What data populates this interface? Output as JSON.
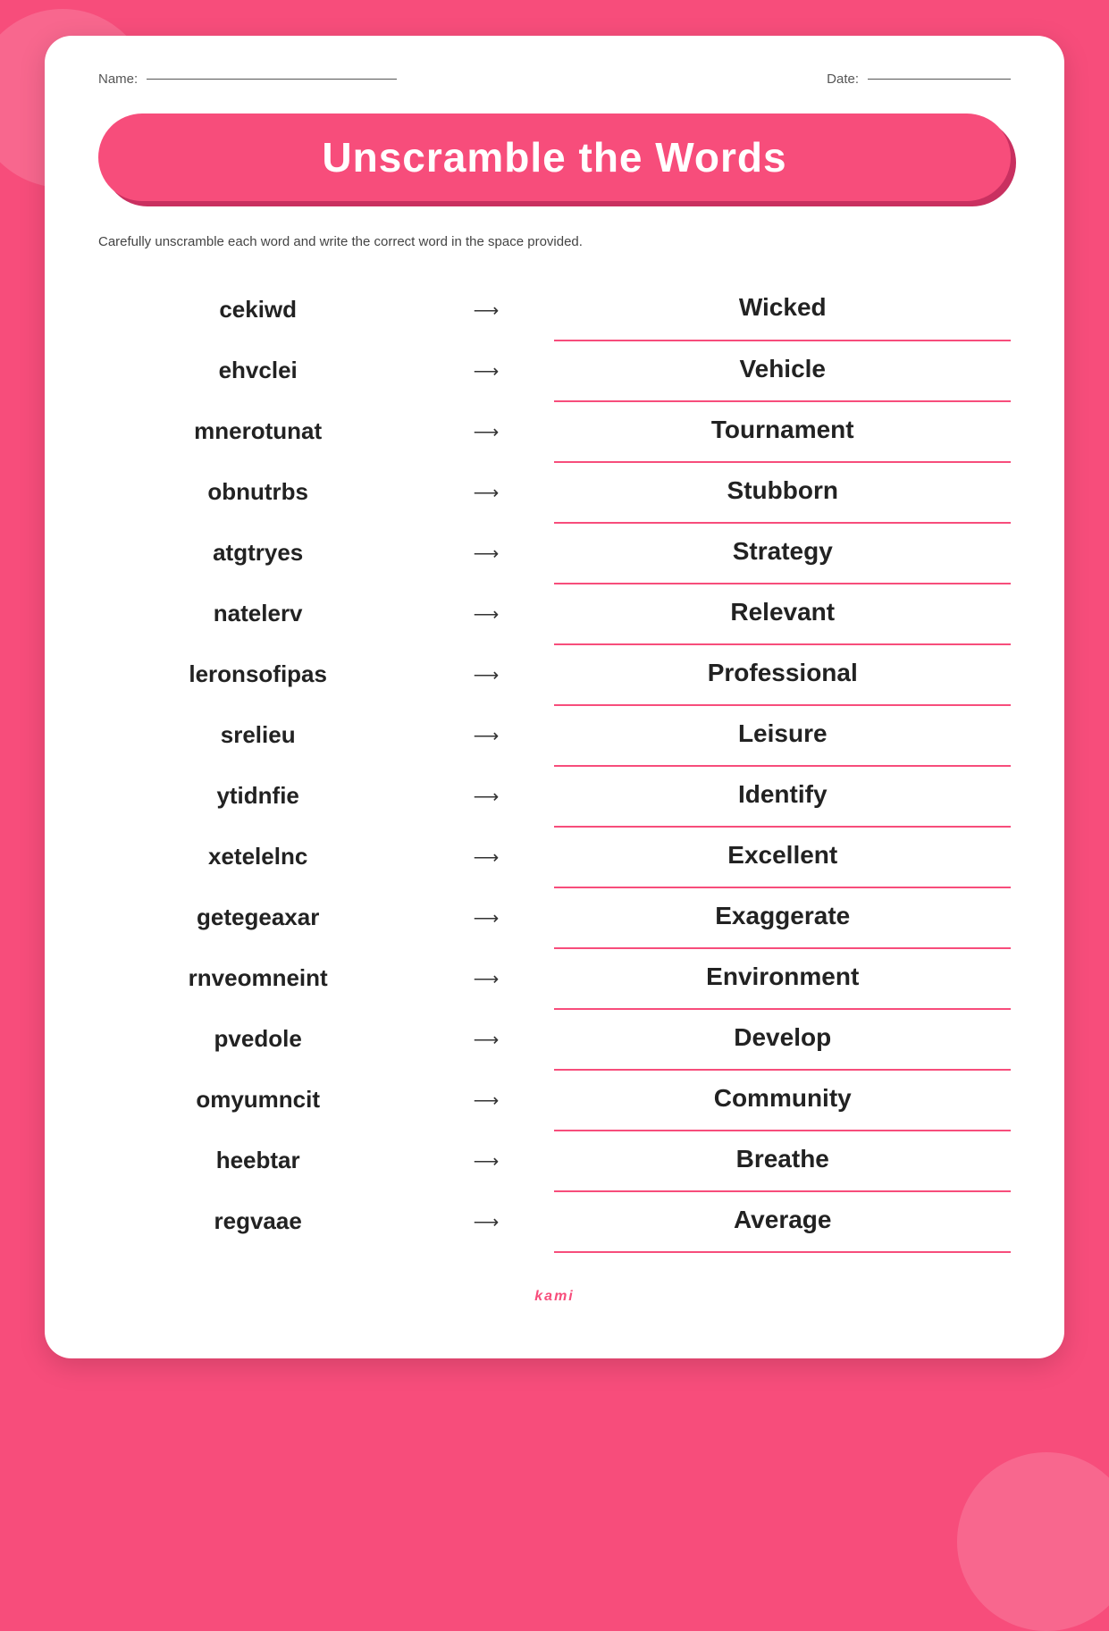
{
  "header": {
    "name_label": "Name:",
    "date_label": "Date:"
  },
  "title": "Unscramble the Words",
  "instructions": "Carefully unscramble each word and write the correct word in the space provided.",
  "words": [
    {
      "scrambled": "cekiwd",
      "answer": "Wicked"
    },
    {
      "scrambled": "ehvclei",
      "answer": "Vehicle"
    },
    {
      "scrambled": "mnerotunat",
      "answer": "Tournament"
    },
    {
      "scrambled": "obnutrbs",
      "answer": "Stubborn"
    },
    {
      "scrambled": "atgtryes",
      "answer": "Strategy"
    },
    {
      "scrambled": "natelerv",
      "answer": "Relevant"
    },
    {
      "scrambled": "leronsofipas",
      "answer": "Professional"
    },
    {
      "scrambled": "srelieu",
      "answer": "Leisure"
    },
    {
      "scrambled": "ytidnfie",
      "answer": "Identify"
    },
    {
      "scrambled": "xetelelnc",
      "answer": "Excellent"
    },
    {
      "scrambled": "getegeaxar",
      "answer": "Exaggerate"
    },
    {
      "scrambled": "rnveomneint",
      "answer": "Environment"
    },
    {
      "scrambled": "pvedole",
      "answer": "Develop"
    },
    {
      "scrambled": "omyumncit",
      "answer": "Community"
    },
    {
      "scrambled": "heebtar",
      "answer": "Breathe"
    },
    {
      "scrambled": "regvaae",
      "answer": "Average"
    }
  ],
  "arrow": "⟶",
  "footer": "kami",
  "colors": {
    "primary": "#f74d7b",
    "shadow": "#c93060",
    "text_dark": "#222",
    "text_muted": "#555"
  }
}
